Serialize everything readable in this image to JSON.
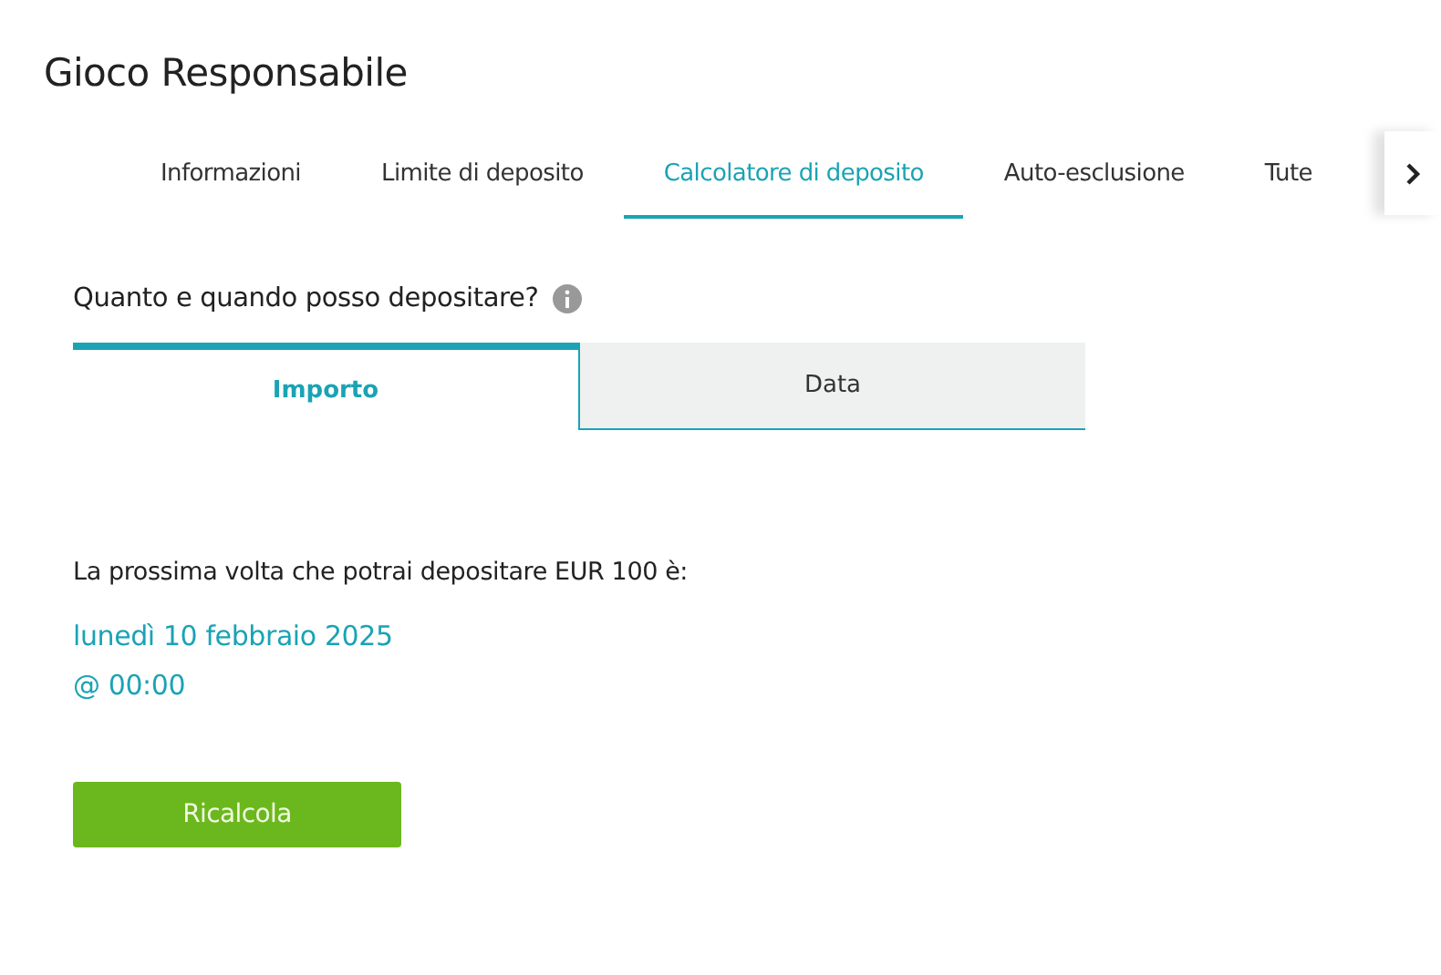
{
  "title": "Gioco Responsabile",
  "tabs": [
    {
      "label": "Informazioni",
      "selected": false
    },
    {
      "label": "Limite di deposito",
      "selected": false
    },
    {
      "label": "Calcolatore di deposito",
      "selected": true
    },
    {
      "label": "Auto-esclusione",
      "selected": false
    },
    {
      "label": "Tute",
      "selected": false
    }
  ],
  "question": "Quanto e quando posso depositare?",
  "subtabs": [
    {
      "label": "Importo",
      "selected": true
    },
    {
      "label": "Data",
      "selected": false
    }
  ],
  "message": "La prossima volta che potrai depositare EUR 100 è:",
  "date": "lunedì 10 febbraio 2025",
  "time": "@ 00:00",
  "button": "Ricalcola"
}
